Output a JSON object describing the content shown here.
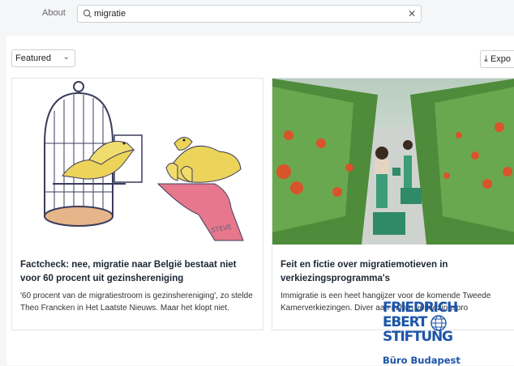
{
  "header": {
    "about_label": "About",
    "search": {
      "value": "migratie",
      "placeholder": ""
    }
  },
  "toolbar": {
    "sort_selected": "Featured",
    "export_label": "Expo"
  },
  "cards": [
    {
      "title": "Factcheck: nee, migratie naar België bestaat niet voor 60 procent uit gezinshereniging",
      "excerpt": "'60 procent van de migratiestroom is gezinshereniging', zo stelde Theo Francken in Het Laatste Nieuws. Maar het klopt niet.",
      "illustration_signature": "STEVE"
    },
    {
      "title": "Feit en fictie over migratiemotieven in verkiezingsprogramma's",
      "excerpt": "Immigratie is een heet hangijzer voor de komende Tweede Kamerverkiezingen. Diver aan in hun verkiezingspro"
    }
  ],
  "watermark": {
    "logo_lines": [
      "FRIEDRICH",
      "EBERT",
      "STIFTUNG"
    ],
    "office": "Büro Budapest"
  },
  "colors": {
    "brand_blue": "#1c55a8",
    "page_bg": "#f5f6f8"
  }
}
